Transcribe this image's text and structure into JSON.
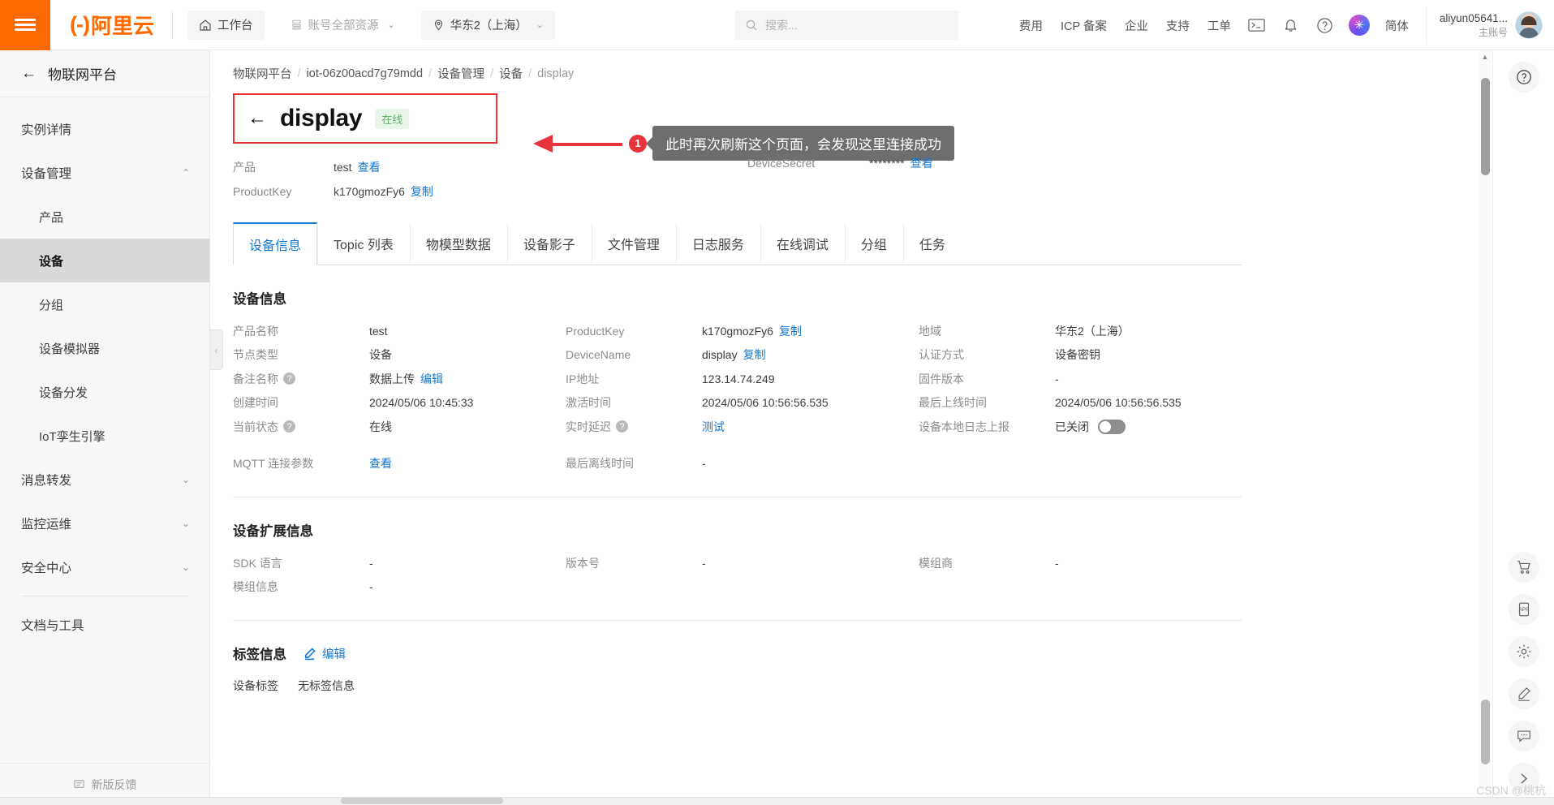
{
  "topbar": {
    "menu_icon": "hamburger-icon",
    "brand": {
      "mark": "(-)",
      "name": "阿里云"
    },
    "workbench": {
      "label": "工作台",
      "icon": "home-icon"
    },
    "resources": {
      "label": "账号全部资源",
      "icon": "list-icon",
      "caret": "⌄"
    },
    "region": {
      "label": "华东2（上海）",
      "icon": "location-icon",
      "caret": "⌄"
    },
    "search": {
      "placeholder": "搜索...",
      "value": "",
      "icon": "search-icon"
    },
    "nav": [
      "费用",
      "ICP 备案",
      "企业",
      "支持",
      "工单"
    ],
    "icons": [
      "terminal-icon",
      "bell-icon",
      "help-icon",
      "ai-assistant-icon"
    ],
    "language": "简体",
    "account": {
      "name": "aliyun05641...",
      "sub": "主账号"
    }
  },
  "sidebar": {
    "header": {
      "back": "←",
      "title": "物联网平台"
    },
    "items": [
      {
        "label": "实例详情",
        "type": "item"
      },
      {
        "label": "设备管理",
        "type": "group",
        "caret": "⌃"
      },
      {
        "label": "产品",
        "type": "sub"
      },
      {
        "label": "设备",
        "type": "sub",
        "active": true
      },
      {
        "label": "分组",
        "type": "sub"
      },
      {
        "label": "设备模拟器",
        "type": "sub"
      },
      {
        "label": "设备分发",
        "type": "sub"
      },
      {
        "label": "IoT孪生引擎",
        "type": "sub"
      },
      {
        "label": "消息转发",
        "type": "group",
        "caret": "⌄"
      },
      {
        "label": "监控运维",
        "type": "group",
        "caret": "⌄"
      },
      {
        "label": "安全中心",
        "type": "group",
        "caret": "⌄"
      },
      {
        "label": "文档与工具",
        "type": "item"
      }
    ],
    "footer": {
      "label": "新版反馈",
      "icon": "feedback-icon"
    },
    "collapse": "‹"
  },
  "main": {
    "breadcrumb": [
      "物联网平台",
      "iot-06z00acd7g79mdd",
      "设备管理",
      "设备",
      "display"
    ],
    "page_title": "display",
    "status_badge": "在线",
    "back_arrow": "←",
    "annotation": {
      "number": "1",
      "text": "此时再次刷新这个页面，会发现这里连接成功",
      "highlight_color": "#e8333a"
    },
    "summary": {
      "product_label": "产品",
      "product_value": "test",
      "product_link": "查看",
      "productkey_label": "ProductKey",
      "productkey_value": "k170gmozFy6",
      "productkey_link": "复制",
      "devicesecret_label": "DeviceSecret",
      "devicesecret_value": "********",
      "devicesecret_link": "查看"
    },
    "tabs": [
      {
        "label": "设备信息",
        "active": true
      },
      {
        "label": "Topic 列表"
      },
      {
        "label": "物模型数据"
      },
      {
        "label": "设备影子"
      },
      {
        "label": "文件管理"
      },
      {
        "label": "日志服务"
      },
      {
        "label": "在线调试"
      },
      {
        "label": "分组"
      },
      {
        "label": "任务"
      }
    ],
    "device_info": {
      "title": "设备信息",
      "col1": [
        {
          "k": "产品名称",
          "v": "test"
        },
        {
          "k": "节点类型",
          "v": "设备"
        },
        {
          "k": "备注名称",
          "help": true,
          "v": "数据上传",
          "link": "编辑"
        },
        {
          "k": "创建时间",
          "v": "2024/05/06 10:45:33"
        },
        {
          "k": "当前状态",
          "help": true,
          "v": "在线"
        },
        {
          "k": "MQTT 连接参数",
          "link_only": "查看"
        }
      ],
      "col2": [
        {
          "k": "ProductKey",
          "v": "k170gmozFy6",
          "link": "复制"
        },
        {
          "k": "DeviceName",
          "v": "display",
          "link": "复制"
        },
        {
          "k": "IP地址",
          "v": "123.14.74.249"
        },
        {
          "k": "激活时间",
          "v": "2024/05/06 10:56:56.535"
        },
        {
          "k": "实时延迟",
          "help": true,
          "link_only": "测试"
        },
        {
          "k": "最后离线时间",
          "v": "-"
        }
      ],
      "col3": [
        {
          "k": "地域",
          "v": "华东2（上海）"
        },
        {
          "k": "认证方式",
          "v": "设备密钥"
        },
        {
          "k": "固件版本",
          "v": "-"
        },
        {
          "k": "最后上线时间",
          "v": "2024/05/06 10:56:56.535"
        },
        {
          "k": "设备本地日志上报",
          "v": "已关闭",
          "toggle": "off"
        }
      ]
    },
    "extended_info": {
      "title": "设备扩展信息",
      "col1": [
        {
          "k": "SDK 语言",
          "v": "-"
        },
        {
          "k": "模组信息",
          "v": "-"
        }
      ],
      "col2": [
        {
          "k": "版本号",
          "v": "-"
        }
      ],
      "col3": [
        {
          "k": "模组商",
          "v": "-"
        }
      ]
    },
    "tag_info": {
      "title": "标签信息",
      "edit_label": "编辑",
      "edit_icon": "pencil-icon",
      "row_label": "设备标签",
      "row_value": "无标签信息"
    }
  },
  "rail": {
    "help": "help-icon",
    "buttons": [
      "cart-icon",
      "app-icon",
      "gear-icon",
      "pencil-icon",
      "chat-icon",
      "chevron-right-icon"
    ]
  },
  "watermark": "CSDN @桃杭"
}
